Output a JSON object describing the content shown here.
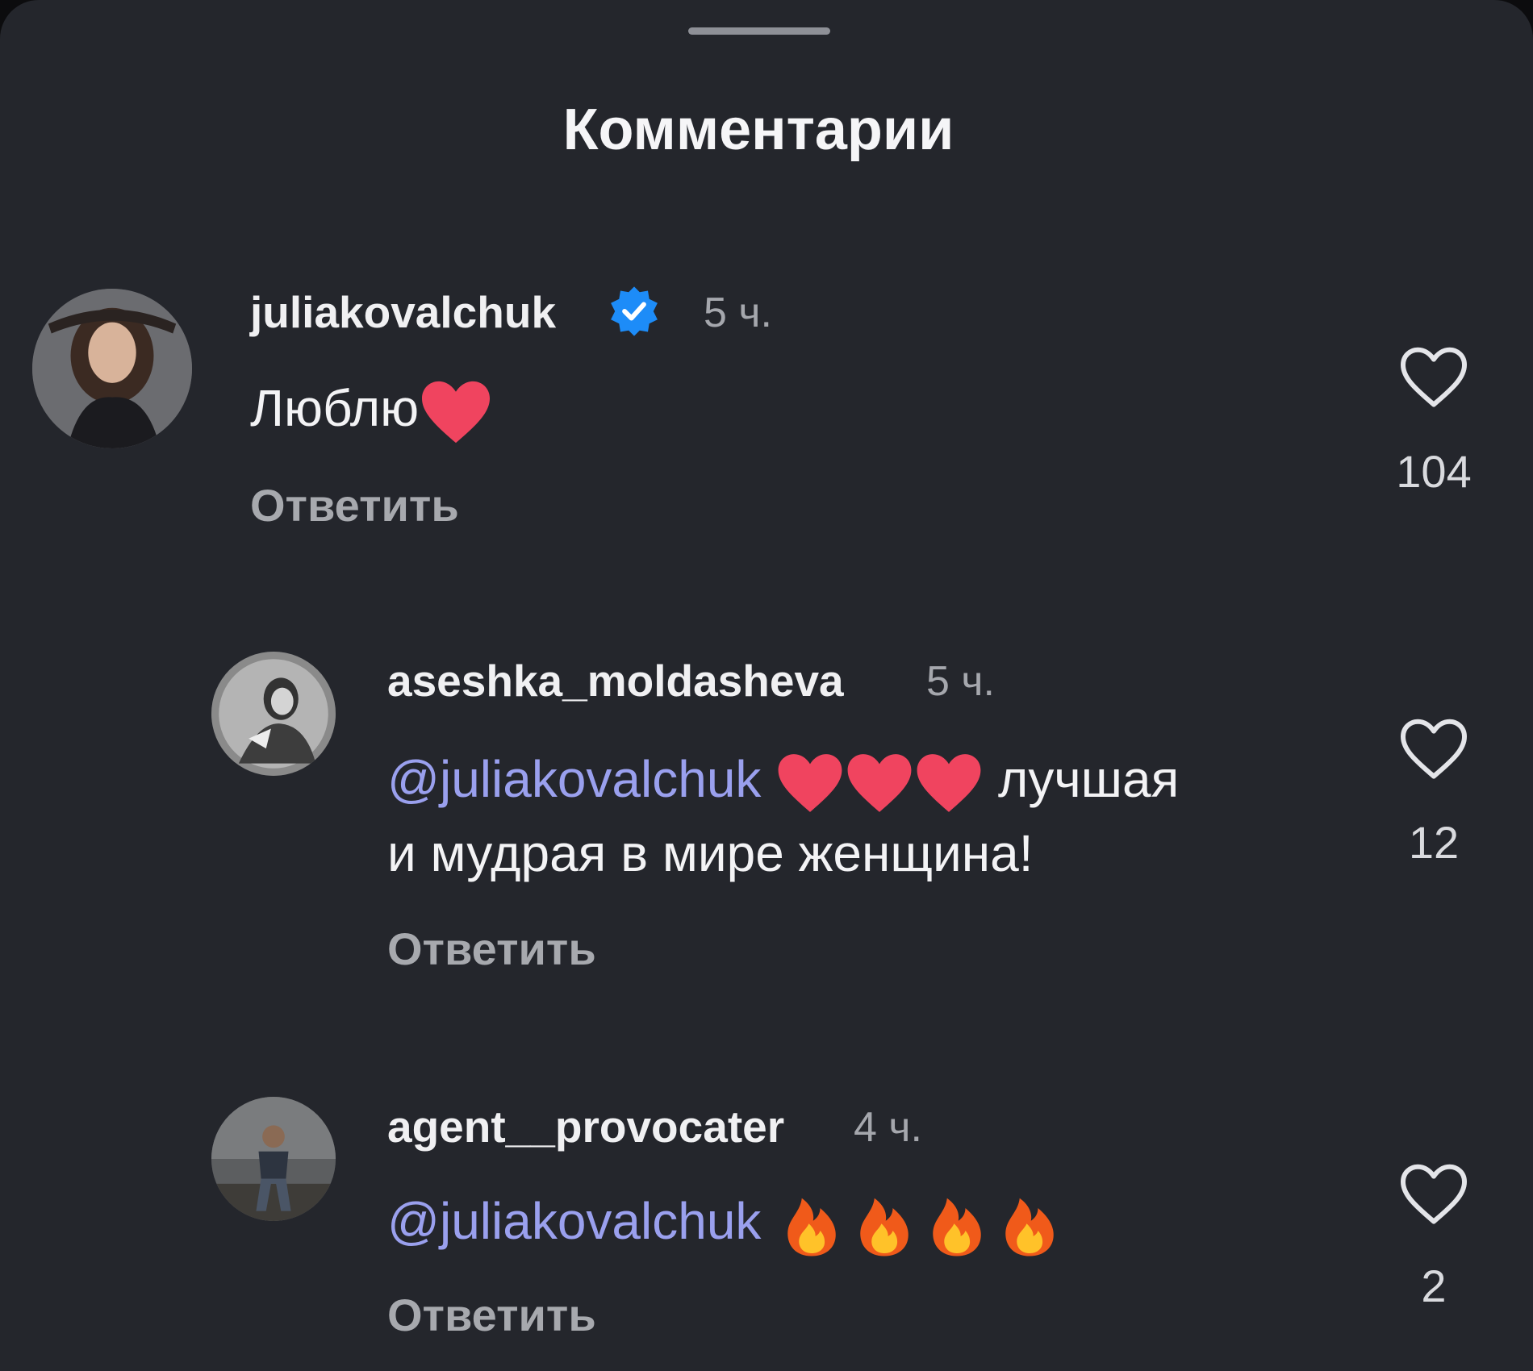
{
  "sheet": {
    "title": "Комментарии"
  },
  "comments": [
    {
      "username": "juliakovalchuk",
      "verified": true,
      "time": "5 ч.",
      "text": "Люблю",
      "emoji": [
        "red-heart"
      ],
      "reply_label": "Ответить",
      "likes": "104"
    },
    {
      "username": "aseshka_moldasheva",
      "verified": false,
      "time": "5 ч.",
      "mention": "@juliakovalchuk",
      "emoji": [
        "red-heart",
        "red-heart",
        "red-heart"
      ],
      "text_after_emoji": "лучшая",
      "text_line2": "и мудрая в мире женщина!",
      "reply_label": "Ответить",
      "likes": "12"
    },
    {
      "username": "agent__provocater",
      "verified": false,
      "time": "4 ч.",
      "mention": "@juliakovalchuk",
      "emoji": [
        "fire",
        "fire",
        "fire",
        "fire"
      ],
      "reply_label": "Ответить",
      "likes": "2"
    }
  ],
  "colors": {
    "background": "#24262c",
    "mention": "#9aa0ee",
    "verified": "#1d8cf8",
    "heart_emoji": "#f0445f",
    "secondary_text": "#a7a9ae"
  },
  "icons": {
    "like": "heart-outline-icon",
    "verified": "verified-badge-icon"
  }
}
